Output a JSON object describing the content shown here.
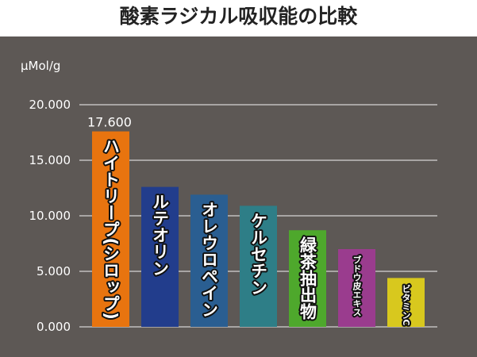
{
  "title": "酸素ラジカル吸収能の比較",
  "colors": {
    "panel": "#5d5855",
    "grid": "#f2f2f2",
    "text": "#ffffff"
  },
  "chart_data": {
    "type": "bar",
    "title": "酸素ラジカル吸収能の比較",
    "ylabel": "μMol/g",
    "ylim": [
      0,
      20000
    ],
    "yticks": [
      0,
      5000,
      10000,
      15000,
      20000
    ],
    "ytick_labels": [
      "0.000",
      "5.000",
      "10.000",
      "15.000",
      "20.000"
    ],
    "grid": true,
    "categories": [
      "ハイトリープ(シロップ)",
      "ルテオリン",
      "オレウロペイン",
      "ケルセチン",
      "緑茶抽出物",
      "ブドウ皮エキス",
      "ビタミンC"
    ],
    "values": [
      17600,
      12600,
      11900,
      10900,
      8700,
      7000,
      4400
    ],
    "colors": [
      "#e8740f",
      "#223d8c",
      "#2a5e91",
      "#2e7e87",
      "#4ea82c",
      "#9a3c8e",
      "#d8c81e"
    ],
    "data_labels": [
      "17.600",
      null,
      null,
      null,
      null,
      null,
      null
    ]
  }
}
